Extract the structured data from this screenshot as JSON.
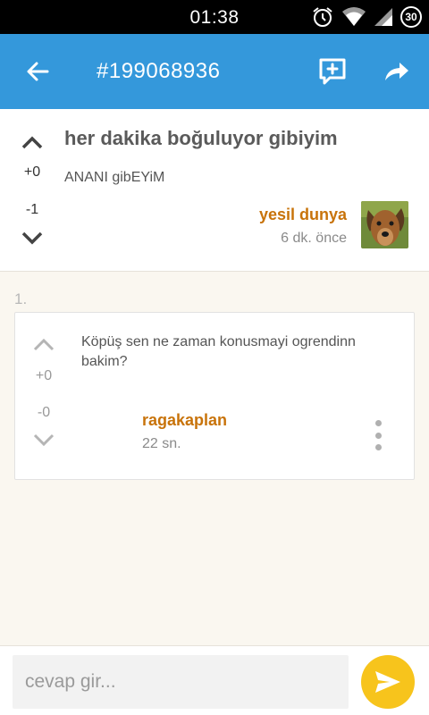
{
  "status_bar": {
    "time": "01:38",
    "battery": "30",
    "icons": [
      "alarm-icon",
      "wifi-icon",
      "signal-icon",
      "battery-icon"
    ]
  },
  "app_bar": {
    "title": "#199068936",
    "color": "#3498db",
    "icons": [
      "back-arrow-icon",
      "add-comment-icon",
      "share-icon"
    ]
  },
  "post": {
    "title": "her dakika boğuluyor gibiyim",
    "body": "ANANI gibEYiM",
    "score_up": "+0",
    "score_down": "-1",
    "author": "yesil dunya",
    "time": "6 dk. önce",
    "author_color": "#c8730a"
  },
  "comments": [
    {
      "index": "1.",
      "text": "Köpüş sen ne zaman konusmayi ogrendinn bakim?",
      "score_up": "+0",
      "score_down": "-0",
      "author": "ragakaplan",
      "time": "22 sn."
    }
  ],
  "reply": {
    "placeholder": "cevap gir...",
    "send_color": "#f7c41c"
  }
}
